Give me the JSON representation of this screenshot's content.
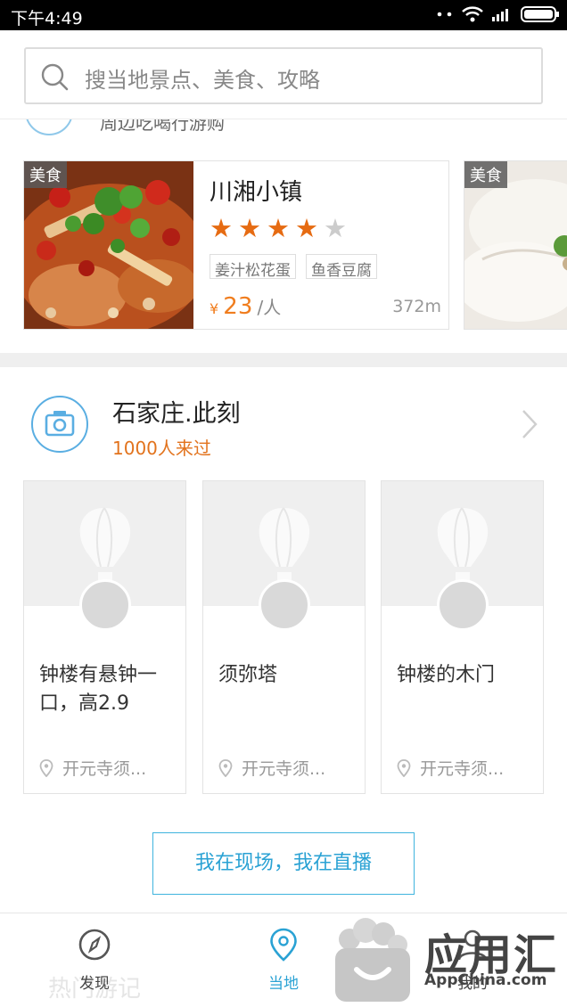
{
  "status_bar": {
    "time": "下午4:49"
  },
  "search": {
    "placeholder": "搜当地景点、美食、攻略"
  },
  "nearby_section": {
    "label": "周边吃喝行游购"
  },
  "food_cards": [
    {
      "tag": "美食",
      "name": "川湘小镇",
      "rating": 4,
      "max_rating": 5,
      "dishes": [
        "姜汁松花蛋",
        "鱼香豆腐"
      ],
      "currency": "¥",
      "price": "23",
      "price_unit": "/人",
      "distance": "372m"
    },
    {
      "tag": "美食"
    }
  ],
  "moment": {
    "title": "石家庄.此刻",
    "subtitle": "1000人来过",
    "posts": [
      {
        "text": "钟楼有悬钟一口，高2.9",
        "location": "开元寺须..."
      },
      {
        "text": "须弥塔",
        "location": "开元寺须..."
      },
      {
        "text": "钟楼的木门",
        "location": "开元寺须..."
      }
    ]
  },
  "live_button": {
    "label": "我在现场，我在直播"
  },
  "background_text": "热门游记",
  "tabbar": {
    "items": [
      {
        "label": "发现",
        "icon": "compass-icon",
        "active": false
      },
      {
        "label": "当地",
        "icon": "location-pin-icon",
        "active": true
      },
      {
        "label": "我的",
        "icon": "person-icon",
        "active": false
      }
    ]
  },
  "watermark": {
    "brand": "应用汇",
    "url": "AppChina.com"
  },
  "colors": {
    "accent": "#2aa2d4",
    "star": "#e66b12",
    "star_empty": "#cccccc",
    "sub_orange": "#e2731d"
  }
}
